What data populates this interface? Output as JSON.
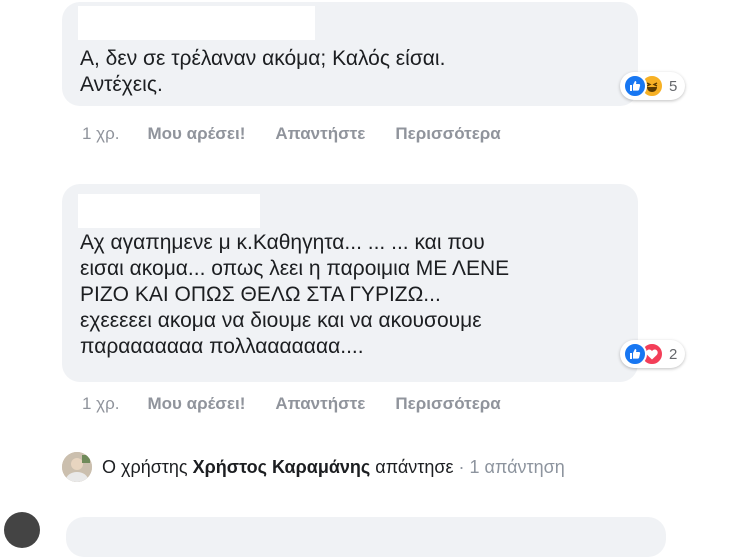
{
  "comments": [
    {
      "text": "Α, δεν σε τρέλαναν ακόμα; Καλός είσαι.\nΑντέχεις.",
      "reactions": {
        "icons": [
          "like-icon",
          "haha-icon"
        ],
        "count": "5"
      },
      "actions": {
        "time": "1 χρ.",
        "like": "Μου αρέσει!",
        "reply": "Απαντήστε",
        "more": "Περισσότερα"
      }
    },
    {
      "text": "Αχ αγαπημενε μ κ.Καθηγητα... ... ... και που\nεισαι ακομα... οπως λεει η παροιμια ΜΕ ΛΕΝΕ\nΡΙΖΟ ΚΑΙ ΟΠΩΣ ΘΕΛΩ ΣΤΑ ΓΥΡΙΖΩ...\nεχεεεεει ακομα να διουμε και να ακουσουμε\nπαρααααααα πολλααααααα....",
      "reactions": {
        "icons": [
          "like-icon",
          "love-icon"
        ],
        "count": "2"
      },
      "actions": {
        "time": "1 χρ.",
        "like": "Μου αρέσει!",
        "reply": "Απαντήστε",
        "more": "Περισσότερα"
      }
    }
  ],
  "reply_summary": {
    "prefix": "Ο χρήστης",
    "user": "Χρήστος Καραμάνης",
    "verb": "απάντησε",
    "separator": "·",
    "count": "1 απάντηση"
  },
  "colors": {
    "bubble": "#f0f2f5",
    "like": "#1877f2",
    "haha": "#f7b125",
    "love": "#f33e58",
    "meta_text": "#90949c"
  }
}
